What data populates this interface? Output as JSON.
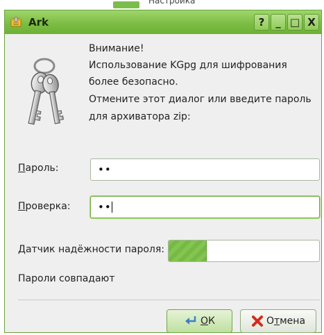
{
  "background_window": {
    "text": "Настройка"
  },
  "window": {
    "title": "Ark",
    "controls": {
      "help": "?",
      "minimize": "_",
      "maximize": "□",
      "close": "X"
    },
    "message_lines": [
      "Внимание!",
      "Использование KGpg для шифрования",
      "более безопасно.",
      "Отмените этот диалог или введите пароль",
      "для архиватора zip:"
    ],
    "password": {
      "label_mnemonic": "П",
      "label_rest": "ароль:",
      "value": "••"
    },
    "verify": {
      "label_mnemonic": "П",
      "label_rest": "роверка:",
      "value": "••"
    },
    "strength": {
      "label": "Датчик надёжности пароля:",
      "level": 0.25
    },
    "status": "Пароли совпадают",
    "buttons": {
      "ok_mnemonic": "О",
      "ok_rest": "К",
      "cancel_before": "О",
      "cancel_mnemonic": "т",
      "cancel_rest": "мена"
    }
  },
  "colors": {
    "titlebar": "#7dbd44",
    "accent": "#6eb036",
    "dialog_bg": "#eeefee"
  },
  "icons": [
    "app-archive-icon",
    "keys-icon",
    "ok-arrow-icon",
    "cancel-x-icon"
  ]
}
